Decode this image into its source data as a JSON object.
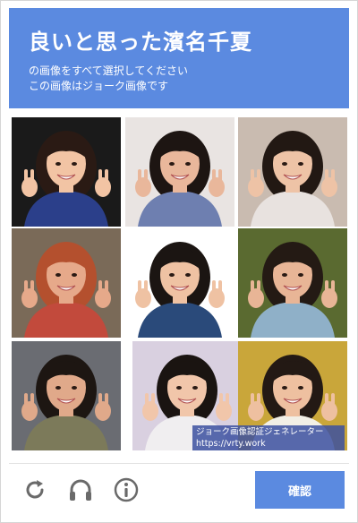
{
  "header": {
    "title": "良いと思った濱名千夏",
    "instruction_line1": "の画像をすべて選択してください",
    "instruction_line2": "この画像はジョーク画像です"
  },
  "grid": {
    "tiles": [
      {
        "label": "tile-1",
        "bg": "#1a1a1a",
        "shirt": "#2b3f8a",
        "hair": "#2a1a14",
        "skin": "#f2c4a4"
      },
      {
        "label": "tile-2",
        "bg": "#e9e4e2",
        "shirt": "#6e7fb0",
        "hair": "#1d1512",
        "skin": "#e9b79b"
      },
      {
        "label": "tile-3",
        "bg": "#c9bbb0",
        "shirt": "#e8e2df",
        "hair": "#221813",
        "skin": "#eec3a6"
      },
      {
        "label": "tile-4",
        "bg": "#7a6a58",
        "shirt": "#c24a3c",
        "hair": "#b4502e",
        "skin": "#e6a98a"
      },
      {
        "label": "tile-5",
        "bg": "#ffffff",
        "shirt": "#2a4a7a",
        "hair": "#1b1512",
        "skin": "#efc2a3"
      },
      {
        "label": "tile-6",
        "bg": "#5a6a30",
        "shirt": "#8fb0c8",
        "hair": "#241a14",
        "skin": "#e8b596"
      },
      {
        "label": "tile-7",
        "bg": "#6a6c72",
        "shirt": "#7c7a5a",
        "hair": "#1d1612",
        "skin": "#e0a98a"
      },
      {
        "label": "tile-8",
        "bg": "#d9d0e0",
        "shirt": "#f0eef0",
        "hair": "#1a1411",
        "skin": "#f1c6aa"
      },
      {
        "label": "tile-9",
        "bg": "#c9a63a",
        "shirt": "#f2efe6",
        "hair": "#231914",
        "skin": "#eec0a0"
      }
    ]
  },
  "watermark": {
    "line1": "ジョーク画像認証ジェネレーター",
    "line2": "https://vrty.work"
  },
  "footer": {
    "verify_label": "確認",
    "icons": [
      "reload-icon",
      "audio-headphones-icon",
      "info-icon"
    ]
  },
  "colors": {
    "accent": "#5b8ae0"
  }
}
